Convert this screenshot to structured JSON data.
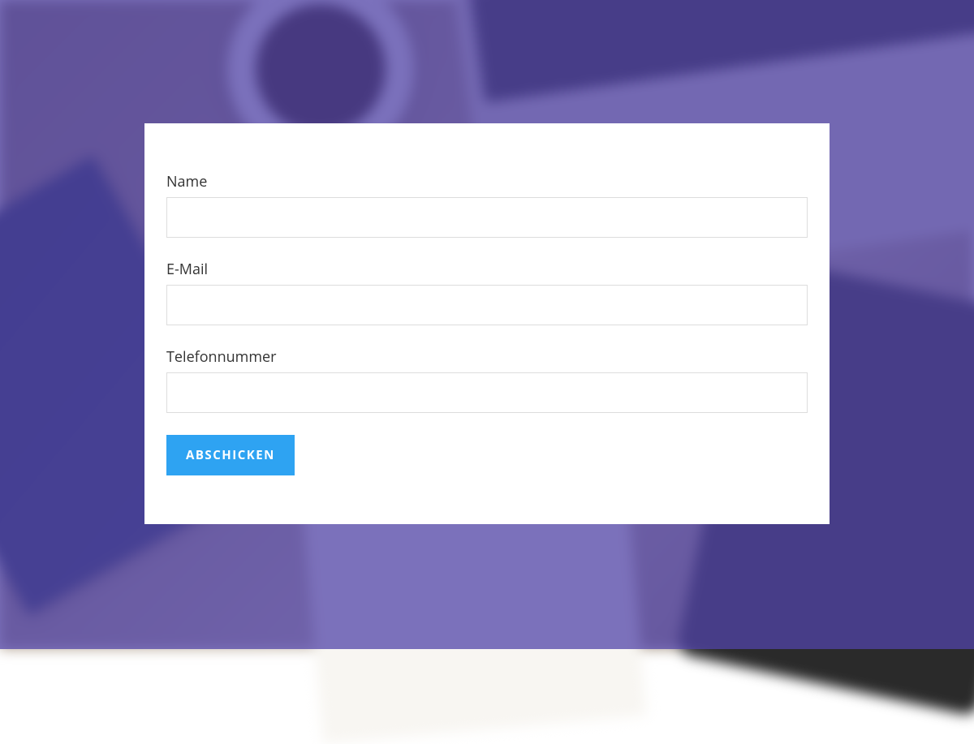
{
  "form": {
    "fields": {
      "name": {
        "label": "Name",
        "value": ""
      },
      "email": {
        "label": "E-Mail",
        "value": ""
      },
      "phone": {
        "label": "Telefonnummer",
        "value": ""
      }
    },
    "submit_label": "ABSCHICKEN"
  },
  "colors": {
    "overlay": "rgba(82, 68, 168, 0.75)",
    "button": "#2ea3f2",
    "card": "#ffffff"
  }
}
